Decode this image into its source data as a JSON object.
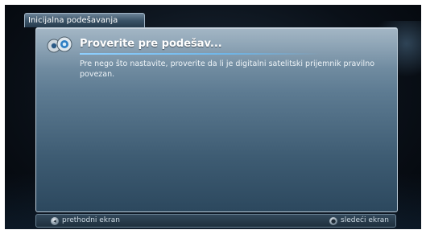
{
  "breadcrumb": {
    "label": "Inicijalna podešavanja"
  },
  "dialog": {
    "title": "Proverite pre podešav...",
    "body": "Pre nego što nastavite, proverite da li je digitalni satelitski prijemnik pravilno povezan.",
    "icon": "settings-gears-icon"
  },
  "footer": {
    "prev_label": "prethodni ekran",
    "prev_icon": "back-key-icon",
    "next_label": "sledeći ekran",
    "next_icon": "ok-key-icon"
  },
  "colors": {
    "accent": "#6fb6e8",
    "panel": "#5d7b92",
    "background": "#0a1018"
  }
}
